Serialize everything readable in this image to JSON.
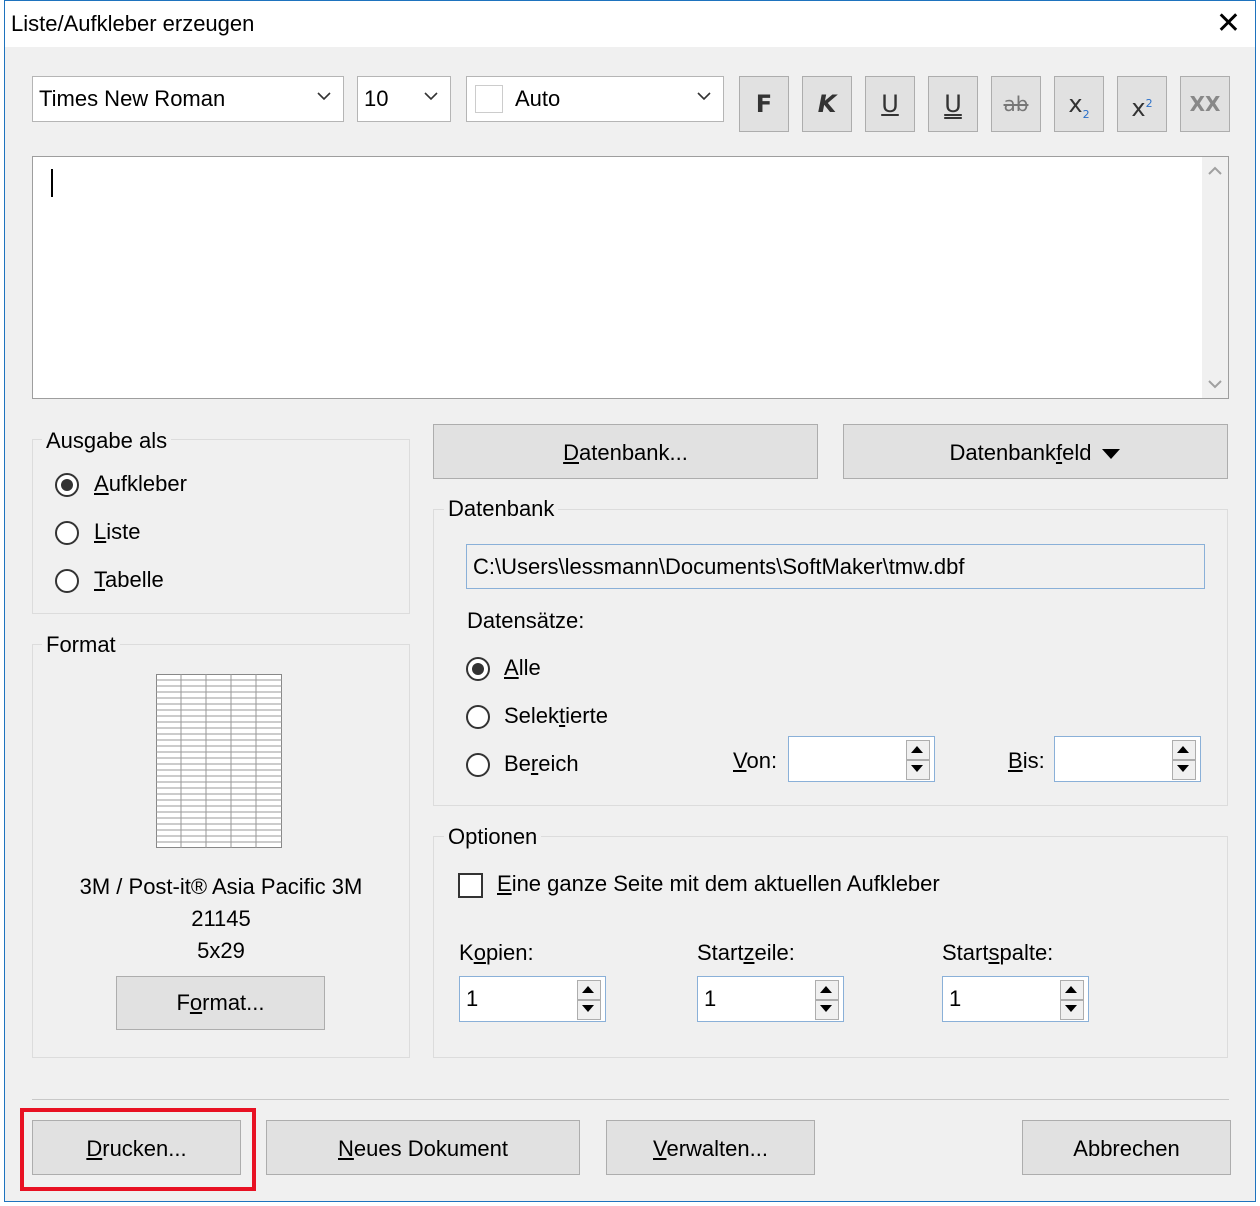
{
  "window": {
    "title": "Liste/Aufkleber erzeugen",
    "close_glyph": "✕"
  },
  "toolbar": {
    "font": "Times New Roman",
    "size": "10",
    "color": "Auto",
    "bold": "F",
    "italic": "K",
    "underline": "U",
    "double_underline": "U",
    "strike": "ab",
    "subscript": "x",
    "superscript": "x",
    "caps": "XX"
  },
  "ausgabe": {
    "label": "Ausgabe als",
    "options": [
      {
        "pre": "",
        "u": "A",
        "post": "ufkleber",
        "selected": true
      },
      {
        "pre": "",
        "u": "L",
        "post": "iste",
        "selected": false
      },
      {
        "pre": "",
        "u": "T",
        "post": "abelle",
        "selected": false
      }
    ]
  },
  "format": {
    "label": "Format",
    "line1": "3M / Post-it®   Asia Pacific 3M",
    "line2": "21145",
    "line3": "5x29",
    "button_pre": "F",
    "button_u": "o",
    "button_post": "rmat..."
  },
  "datenbank_button": {
    "pre": "",
    "u": "D",
    "post": "atenbank..."
  },
  "datenbankfeld_button": {
    "pre": "Datenbank",
    "u": "f",
    "post": "eld"
  },
  "datenbank": {
    "label": "Datenbank",
    "path": "C:\\Users\\lessmann\\Documents\\SoftMaker\\tmw.dbf",
    "records_label": "Datensätze:",
    "options": [
      {
        "pre": "",
        "u": "A",
        "post": "lle",
        "selected": true
      },
      {
        "pre": "Selek",
        "u": "t",
        "post": "ierte",
        "selected": false
      },
      {
        "pre": "Be",
        "u": "r",
        "post": "eich",
        "selected": false
      }
    ],
    "von_u": "V",
    "von_post": "on:",
    "bis_u": "B",
    "bis_post": "is:",
    "von_value": "",
    "bis_value": ""
  },
  "optionen": {
    "label": "Optionen",
    "checkbox_u": "E",
    "checkbox_post": "ine ganze Seite mit dem aktuellen Aufkleber",
    "kopien_pre": "K",
    "kopien_u": "o",
    "kopien_post": "pien:",
    "startzeile_pre": "Start",
    "startzeile_u": "z",
    "startzeile_post": "eile:",
    "startspalte_pre": "Start",
    "startspalte_u": "s",
    "startspalte_post": "palte:",
    "kopien": "1",
    "startzeile": "1",
    "startspalte": "1"
  },
  "bottom": {
    "drucken_u": "D",
    "drucken_post": "rucken...",
    "neues_u": "N",
    "neues_post": "eues Dokument",
    "verwalten_u": "V",
    "verwalten_post": "erwalten...",
    "abbrechen": "Abbrechen"
  },
  "highlight_color": "#e81123"
}
